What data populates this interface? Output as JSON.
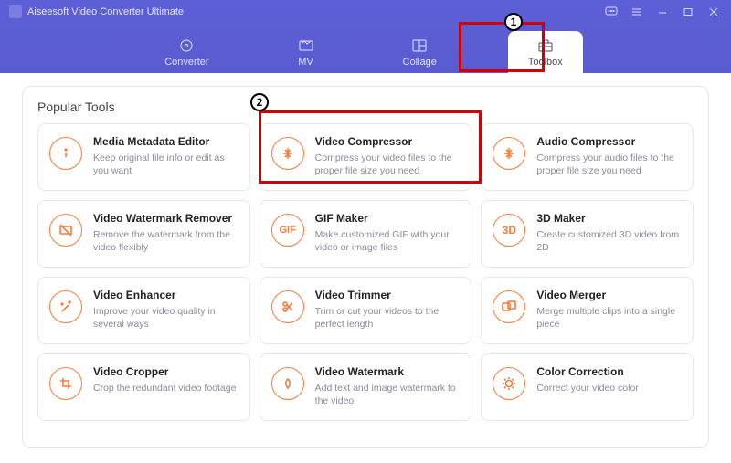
{
  "app": {
    "title": "Aiseesoft Video Converter Ultimate"
  },
  "tabs": {
    "converter": "Converter",
    "mv": "MV",
    "collage": "Collage",
    "toolbox": "Toolbox"
  },
  "section": {
    "popular_tools": "Popular Tools"
  },
  "tools": [
    {
      "icon": "info",
      "title": "Media Metadata Editor",
      "desc": "Keep original file info or edit as you want"
    },
    {
      "icon": "compress",
      "title": "Video Compressor",
      "desc": "Compress your video files to the proper file size you need"
    },
    {
      "icon": "audio-comp",
      "title": "Audio Compressor",
      "desc": "Compress your audio files to the proper file size you need"
    },
    {
      "icon": "wm-remove",
      "title": "Video Watermark Remover",
      "desc": "Remove the watermark from the video flexibly"
    },
    {
      "icon": "gif",
      "title": "GIF Maker",
      "desc": "Make customized GIF with your video or image files"
    },
    {
      "icon": "3d",
      "title": "3D Maker",
      "desc": "Create customized 3D video from 2D"
    },
    {
      "icon": "enhance",
      "title": "Video Enhancer",
      "desc": "Improve your video quality in several ways"
    },
    {
      "icon": "trim",
      "title": "Video Trimmer",
      "desc": "Trim or cut your videos to the perfect length"
    },
    {
      "icon": "merge",
      "title": "Video Merger",
      "desc": "Merge multiple clips into a single piece"
    },
    {
      "icon": "crop",
      "title": "Video Cropper",
      "desc": "Crop the redundant video footage"
    },
    {
      "icon": "watermark",
      "title": "Video Watermark",
      "desc": "Add text and image watermark to the video"
    },
    {
      "icon": "color",
      "title": "Color Correction",
      "desc": "Correct your video color"
    }
  ],
  "annotations": {
    "one": "1",
    "two": "2"
  }
}
